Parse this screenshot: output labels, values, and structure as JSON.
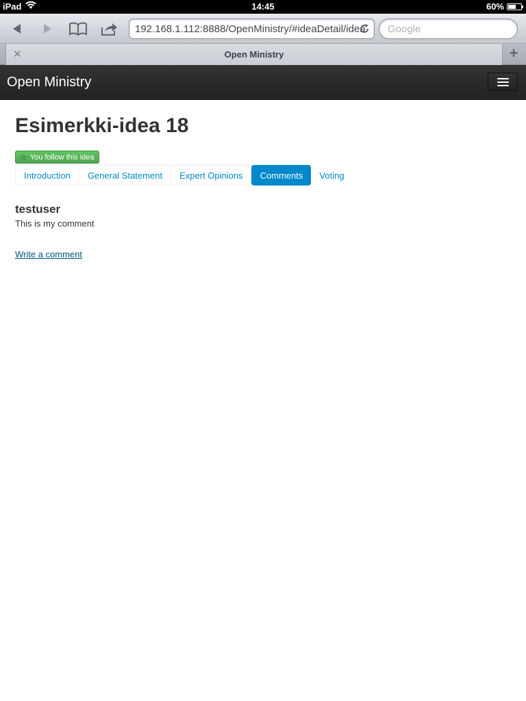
{
  "status_bar": {
    "carrier": "iPad",
    "time": "14:45",
    "battery": "60%",
    "battery_fill": 0.6
  },
  "browser": {
    "url": "192.168.1.112:8888/OpenMinistry/#ideaDetail/idea",
    "search_placeholder": "Google",
    "tab_title": "Open Ministry",
    "icons": {
      "back": "back-arrow-icon",
      "forward": "forward-arrow-icon",
      "bookmarks": "bookmarks-book-icon",
      "share": "share-icon",
      "reload": "reload-icon",
      "close_tab": "close-icon",
      "new_tab": "plus-icon"
    }
  },
  "navbar": {
    "brand": "Open Ministry",
    "toggle_icon": "hamburger-menu-icon"
  },
  "page": {
    "title": "Esimerkki-idea 18",
    "follow_badge": "You follow this idea",
    "follow_badge_icon": "star-icon",
    "tabs": [
      {
        "label": "Introduction",
        "active": false
      },
      {
        "label": "General Statement",
        "active": false
      },
      {
        "label": "Expert Opinions",
        "active": false
      },
      {
        "label": "Comments",
        "active": true
      },
      {
        "label": "Voting",
        "active": false
      }
    ],
    "comments": [
      {
        "author": "testuser",
        "text": "This is my comment"
      }
    ],
    "write_comment_link": "Write a comment"
  },
  "colors": {
    "accent": "#0088cc",
    "badge_green": "#51a351",
    "navbar_bg": "#222222",
    "link": "#005580"
  }
}
